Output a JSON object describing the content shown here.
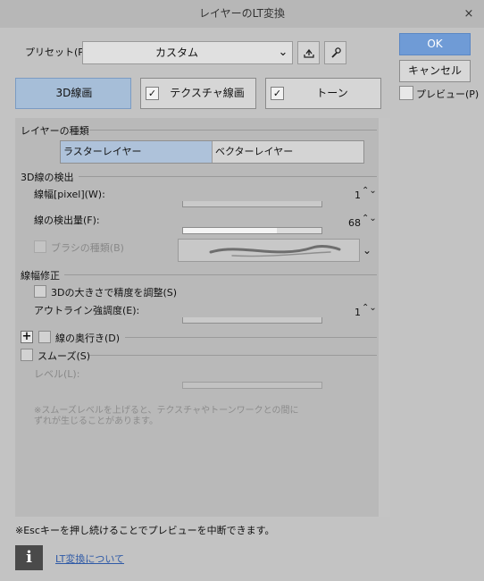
{
  "window": {
    "title": "レイヤーのLT変換",
    "close_icon": "×"
  },
  "preset": {
    "label": "プリセット(P):",
    "value": "カスタム",
    "chevron": "⌄"
  },
  "buttons": {
    "ok": "OK",
    "cancel": "キャンセル"
  },
  "preview": {
    "label": "プレビュー(P)",
    "checked": false
  },
  "tabs": [
    {
      "label": "3D線画",
      "active": true
    },
    {
      "label": "テクスチャ線画",
      "checked": true
    },
    {
      "label": "トーン",
      "checked": true
    }
  ],
  "layer_type": {
    "title": "レイヤーの種類",
    "options": [
      "ラスターレイヤー",
      "ベクターレイヤー"
    ],
    "selected": "ラスターレイヤー"
  },
  "line_detect": {
    "title": "3D線の検出",
    "line_width": {
      "label": "線幅[pixel](W):",
      "value": "1"
    },
    "detect_amount": {
      "label": "線の検出量(F):",
      "value": "68",
      "fraction": 0.68
    },
    "brush_type": {
      "label": "ブラシの種類(B)",
      "enabled": false
    }
  },
  "line_width_fix": {
    "title": "線幅修正",
    "adjust_3d": {
      "label": "3Dの大きさで精度を調整(S)",
      "checked": false
    },
    "outline_strength": {
      "label": "アウトライン強調度(E):",
      "value": "1"
    }
  },
  "line_depth": {
    "label": "線の奥行き(D)",
    "checked": false
  },
  "smooth": {
    "label": "スムーズ(S)",
    "checked": false,
    "level_label": "レベル(L):",
    "note": "※スムーズレベルを上げると、テクスチャやトーンワークとの間に\nずれが生じることがあります。"
  },
  "footer": {
    "note": "※Escキーを押し続けることでプレビューを中断できます。",
    "link": "LT変換について",
    "info_icon": "i"
  },
  "icons": {
    "spin": "⌃⌄",
    "check": "✓",
    "plus": "+"
  }
}
